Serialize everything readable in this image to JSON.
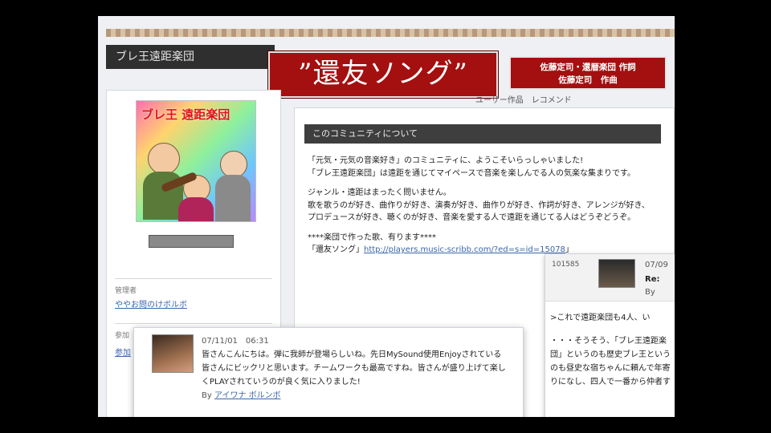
{
  "header": {
    "site_title": "ブレ王遠距楽団",
    "song_title": "”還友ソング”",
    "credit_line1": "佐藤定司・還暦楽団 作詞",
    "credit_line2": "佐藤定司　作曲",
    "nav_text": "ユーザー作品　レコメンド"
  },
  "sidebar": {
    "avatar_caption": "ブレ王 遠距楽団",
    "admin_label": "管理者",
    "admin_name": "ややお問のけボルボ",
    "section_label": "参加",
    "section_link": "参加"
  },
  "about": {
    "header": "このコミュニティについて",
    "line1": "「元気・元気の音楽好き」のコミュニティに、ようこそいらっしゃいました!",
    "line2": "「ブレ王遠距楽団」は遠距を通じてマイペースで音楽を楽しんでる人の気楽な集まりです。",
    "line3": "ジャンル・遠距はまったく問いません。",
    "line4": "歌を歌うのが好き、曲作りが好き、演奏が好き、曲作りが好き、作詞が好き、アレンジが好き、プロデュースが好き、聴くのが好き、音楽を愛する人で遠距を通じてる人はどうぞどうぞ。",
    "line5": "****楽団で作った歌、有ります****",
    "line6_prefix": "「還友ソング」",
    "line6_link": "http://players.music-scribb.com/?ed=s=id=15078",
    "line6_suffix": "」"
  },
  "comment_right": {
    "id": "101585",
    "time": "07/09",
    "re": "Re:",
    "by": "By",
    "text1": ">これで遠距楽団も4人、い",
    "text2": "・・・そうそう、「ブレ王遠距楽団」というのも歴史ブレ王というのも昼史な宿ちゃんに頼んで年寄りになし、四人で一番から仲者す"
  },
  "comment_bottom": {
    "datetime": "07/11/01　06:31",
    "text": "皆さんこんにちは。弾に我師が登場らしいね。先日MySound使用Enjoyされている皆さんにビックリと思います。チームワークも最高ですね。皆さんが盛り上げて楽しくPLAYされていうのが良く気に入りました!",
    "by_label": "By",
    "by_name": "アイワナ ボルンボ"
  },
  "colors": {
    "banner_red": "#a40f10",
    "header_dark": "#3e3e3e",
    "link_blue": "#3a66aa"
  }
}
